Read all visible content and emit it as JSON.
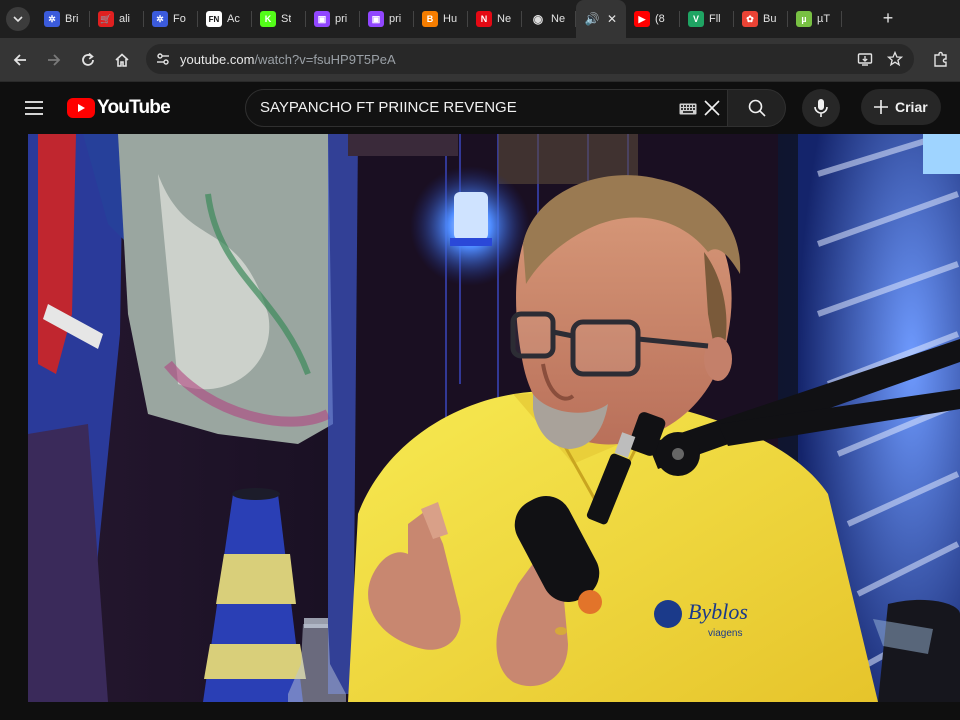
{
  "browser": {
    "tabs": [
      {
        "label": "Bri",
        "icon": "globe-icon",
        "color": "#3b5bdb",
        "glyph": "✲"
      },
      {
        "label": "ali",
        "icon": "cart-icon",
        "color": "#e02020",
        "glyph": "🛒"
      },
      {
        "label": "Fo",
        "icon": "globe-icon",
        "color": "#3b5bdb",
        "glyph": "✲"
      },
      {
        "label": "Ac",
        "icon": "fn-icon",
        "color": "#ffffff",
        "glyph": "FN"
      },
      {
        "label": "St",
        "icon": "kick-icon",
        "color": "#53fc18",
        "glyph": "K"
      },
      {
        "label": "pri",
        "icon": "twitch-icon",
        "color": "#9146ff",
        "glyph": "▣"
      },
      {
        "label": "pri",
        "icon": "twitch-icon",
        "color": "#9146ff",
        "glyph": "▣"
      },
      {
        "label": "Hu",
        "icon": "blogger-icon",
        "color": "#f57d00",
        "glyph": "B"
      },
      {
        "label": "Ne",
        "icon": "netflix-icon",
        "color": "#e50914",
        "glyph": "N"
      },
      {
        "label": "Ne",
        "icon": "chrome-icon",
        "color": "#dddddd",
        "glyph": "◉"
      },
      {
        "label": "",
        "icon": "speaker-icon",
        "color": "#dddddd",
        "glyph": "🔊",
        "active": true
      },
      {
        "label": "(8",
        "icon": "youtube-icon",
        "color": "#ff0000",
        "glyph": "▶"
      },
      {
        "label": "Fll",
        "icon": "vpn-icon",
        "color": "#1fa463",
        "glyph": "V"
      },
      {
        "label": "Bu",
        "icon": "photos-icon",
        "color": "#ea4335",
        "glyph": "✿"
      },
      {
        "label": "µT",
        "icon": "utorrent-icon",
        "color": "#78c043",
        "glyph": "µ"
      }
    ],
    "url_host": "youtube.com",
    "url_path": "/watch?v=fsuHP9T5PeA"
  },
  "youtube": {
    "logo_text": "YouTube",
    "search_query": "SAYPANCHO FT PRIINCE REVENGE",
    "create_label": "Criar"
  },
  "video": {
    "shirt_text_1": "Byblos",
    "shirt_text_2": "viagens"
  },
  "colors": {
    "yt_red": "#ff0000",
    "shirt_yellow": "#f4e23a",
    "neon_blue": "#3a6bff"
  }
}
